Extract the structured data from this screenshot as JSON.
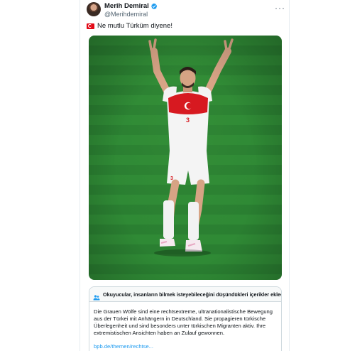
{
  "tweet": {
    "author_name": "Merih Demiral",
    "author_handle": "@Merihdemiral",
    "text": "Ne mutlu Türküm diyene!",
    "flag_icon": "turkey-flag-emoji",
    "player_number": "3"
  },
  "community_note": {
    "title": "Okuyucular, insanların bilmek isteyebileceğini düşündükleri içerikler ekledi",
    "body": "Die Grauen Wölfe sind eine rechtsextreme, ultranationalistische Bewegung aus der Türkei mit Anhängern in Deutschland. Sie propagieren türkische Überlegenheit und sind besonders unter türkischen Migranten aktiv. Ihre extremistischen Ansichten haben an Zulauf gewonnen.",
    "link": "bpb.de/themen/rechtse..."
  },
  "colors": {
    "verified": "#1d9bf0",
    "link": "#1d9bf0",
    "pitch": "#2d8433",
    "jersey_red": "#d71920"
  }
}
